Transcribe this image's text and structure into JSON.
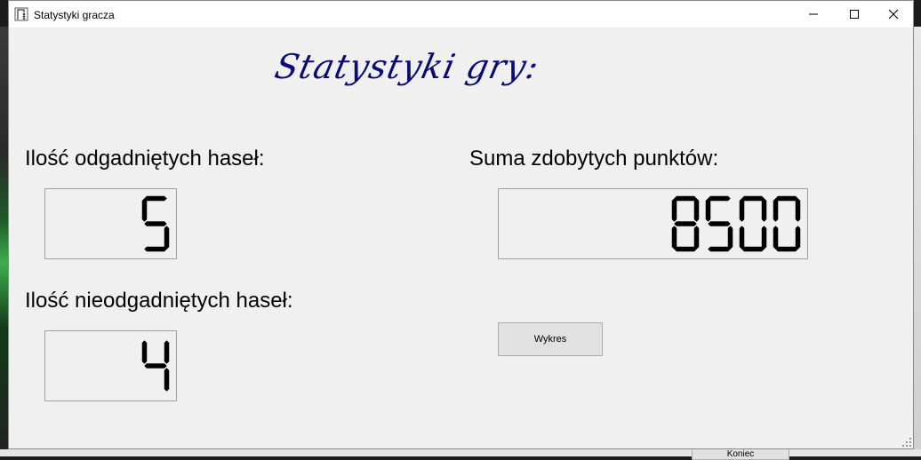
{
  "window": {
    "title": "Statystyki gracza"
  },
  "heading": "Statystyki gry:",
  "stats": {
    "guessed_label": "Ilość odgadniętych haseł:",
    "guessed_value": "5",
    "not_guessed_label": "Ilość nieodgadniętych haseł:",
    "not_guessed_value": "4",
    "points_label": "Suma zdobytych punktów:",
    "points_value": "8500"
  },
  "chart_button": "Wykres",
  "background": {
    "button_label": "Koniec"
  },
  "icons": {
    "app": "app-icon",
    "minimize": "minimize-icon",
    "maximize": "maximize-icon",
    "close": "close-icon",
    "resize": "resize-grip-icon"
  },
  "colors": {
    "heading": "#0a0a7a",
    "panel": "#f0f0f0",
    "digit": "#000000"
  }
}
